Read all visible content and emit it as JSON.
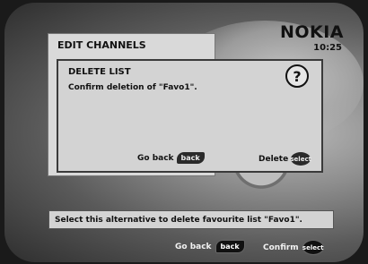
{
  "brand": "NOKIA",
  "clock": "10:25",
  "background_screen": {
    "title": "EDIT CHANNELS"
  },
  "dialog": {
    "title": "DELETE LIST",
    "message": "Confirm deletion of \"Favo1\".",
    "help_symbol": "?",
    "go_back_label": "Go back",
    "go_back_key": "back",
    "delete_label": "Delete",
    "delete_key": "select"
  },
  "hint": "Select this alternative to delete favourite list \"Favo1\".",
  "footer": {
    "go_back_label": "Go back",
    "go_back_key": "back",
    "confirm_label": "Confirm",
    "confirm_key": "select"
  }
}
